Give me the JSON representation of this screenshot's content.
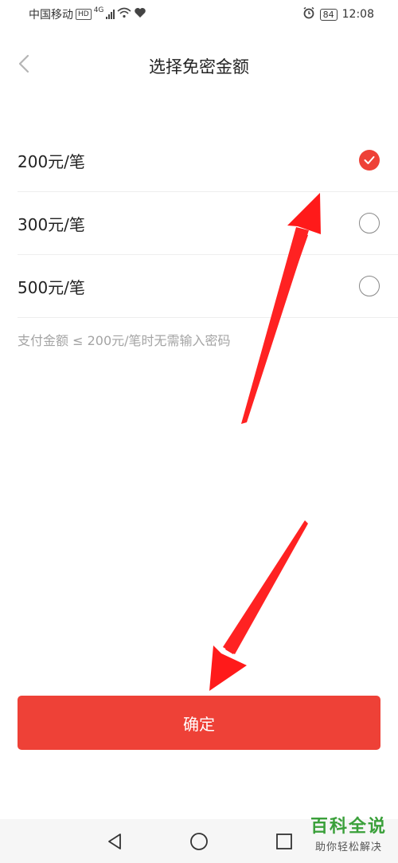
{
  "status_bar": {
    "carrier": "中国移动",
    "hd": "HD",
    "network": "4G",
    "battery": "84",
    "time": "12:08"
  },
  "header": {
    "title": "选择免密金额",
    "back_icon": "chevron-left-icon"
  },
  "options": [
    {
      "label": "200元/笔",
      "selected": true
    },
    {
      "label": "300元/笔",
      "selected": false
    },
    {
      "label": "500元/笔",
      "selected": false
    }
  ],
  "hint": "支付金额 ≤ 200元/笔时无需输入密码",
  "confirm_label": "确定",
  "colors": {
    "accent": "#ee4137",
    "annotation_arrow": "#ff1a1a"
  },
  "watermark": {
    "title": "百科全说",
    "subtitle": "助你轻松解决"
  },
  "system_nav": {
    "back_icon": "triangle-back-icon",
    "home_icon": "circle-home-icon",
    "recent_icon": "square-recent-icon"
  }
}
